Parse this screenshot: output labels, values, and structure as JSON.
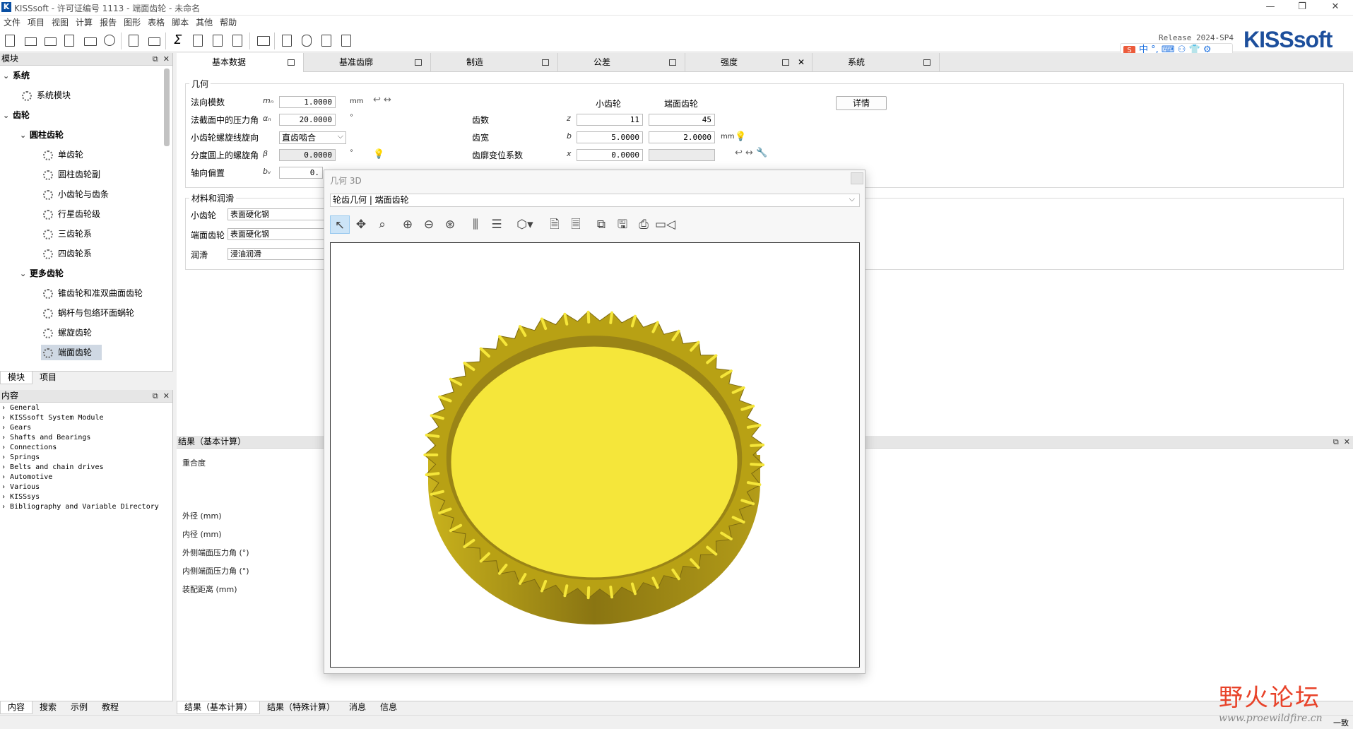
{
  "app": {
    "title": "KISSsoft - 许可证编号 1113 - 端面齿轮 - 未命名",
    "icon": "K",
    "menu": [
      "文件",
      "项目",
      "视图",
      "计算",
      "报告",
      "图形",
      "表格",
      "脚本",
      "其他",
      "帮助"
    ],
    "release": "Release 2024-SP4",
    "brand": "KISSsoft",
    "ime_text": "中 °, ⌨ ⚇ 👕 ⚙"
  },
  "modules": {
    "header": "模块",
    "items": [
      {
        "label": "系统",
        "level": 0,
        "bold": true,
        "toggle": "⌄"
      },
      {
        "label": "系统模块",
        "level": 1,
        "icon": "system-module-icon"
      },
      {
        "label": "齿轮",
        "level": 0,
        "bold": true,
        "toggle": "⌄"
      },
      {
        "label": "圆柱齿轮",
        "level": 1,
        "bold": true,
        "toggle": "⌄"
      },
      {
        "label": "单齿轮",
        "level": 2,
        "icon": "gear-icon"
      },
      {
        "label": "圆柱齿轮副",
        "level": 2,
        "icon": "gear-pair-icon"
      },
      {
        "label": "小齿轮与齿条",
        "level": 2,
        "icon": "rack-icon"
      },
      {
        "label": "行星齿轮级",
        "level": 2,
        "icon": "planetary-icon"
      },
      {
        "label": "三齿轮系",
        "level": 2,
        "icon": "gear-train-icon"
      },
      {
        "label": "四齿轮系",
        "level": 2,
        "icon": "gear-train-icon"
      },
      {
        "label": "更多齿轮",
        "level": 1,
        "bold": true,
        "toggle": "⌄"
      },
      {
        "label": "锥齿轮和准双曲面齿轮",
        "level": 2,
        "icon": "bevel-gear-icon"
      },
      {
        "label": "蜗杆与包络环面蜗轮",
        "level": 2,
        "icon": "worm-icon"
      },
      {
        "label": "螺旋齿轮",
        "level": 2,
        "icon": "crossed-helical-icon"
      },
      {
        "label": "端面齿轮",
        "level": 2,
        "icon": "face-gear-icon",
        "selected": true
      }
    ],
    "tabs": [
      "模块",
      "项目"
    ]
  },
  "content": {
    "header": "内容",
    "items": [
      "General",
      "KISSsoft System Module",
      "Gears",
      "Shafts and Bearings",
      "Connections",
      "Springs",
      "Belts and chain drives",
      "Automotive",
      "Various",
      "KISSsys",
      "Bibliography and Variable Directory"
    ],
    "tabs": [
      "内容",
      "搜索",
      "示例",
      "教程"
    ]
  },
  "main_tabs": [
    "基本数据",
    "基准齿廓",
    "制造",
    "公差",
    "强度",
    "系统"
  ],
  "geometry": {
    "group": "几何",
    "col_pinion": "小齿轮",
    "col_face": "端面齿轮",
    "normal_module": {
      "label": "法向模数",
      "sym": "mₙ",
      "value": "1.0000",
      "unit": "mm"
    },
    "pressure_angle": {
      "label": "法截面中的压力角",
      "sym": "αₙ",
      "value": "20.0000",
      "unit": "°"
    },
    "helix_dir": {
      "label": "小齿轮螺旋线旋向",
      "value": "直齿啮合"
    },
    "helix_angle": {
      "label": "分度圆上的螺旋角",
      "sym": "β",
      "value": "0.0000",
      "unit": "°"
    },
    "axial_offset": {
      "label": "轴向偏置",
      "sym": "bᵥ",
      "value": "0."
    },
    "teeth": {
      "label": "齿数",
      "sym": "z",
      "pinion": "11",
      "face": "45"
    },
    "width": {
      "label": "齿宽",
      "sym": "b",
      "pinion": "5.0000",
      "face": "2.0000",
      "unit": "mm"
    },
    "profile_shift": {
      "label": "齿廓变位系数",
      "sym": "x",
      "pinion": "0.0000",
      "face": ""
    },
    "details_button": "详情"
  },
  "materials": {
    "group": "材料和润滑",
    "pinion": {
      "label": "小齿轮",
      "value": "表面硬化钢"
    },
    "face": {
      "label": "端面齿轮",
      "value": "表面硬化钢"
    },
    "lube": {
      "label": "润滑",
      "value": "浸油润滑"
    }
  },
  "results": {
    "header": "结果（基本计算）",
    "labels": [
      "重合度",
      "外径 (mm)",
      "内径 (mm)",
      "外侧端面压力角 (°)",
      "内侧端面压力角 (°)",
      "装配距离 (mm)"
    ],
    "tabs": [
      "结果（基本计算）",
      "结果（特殊计算）",
      "消息",
      "信息"
    ]
  },
  "dialog": {
    "title": "几何 3D",
    "combo": "轮齿几何 | 端面齿轮",
    "gear_color": "#f5e63a",
    "gear_dark": "#7d6a10"
  },
  "status": {
    "right": "一致"
  },
  "watermark": {
    "title": "野火论坛",
    "url": "www.proewildfire.cn"
  }
}
